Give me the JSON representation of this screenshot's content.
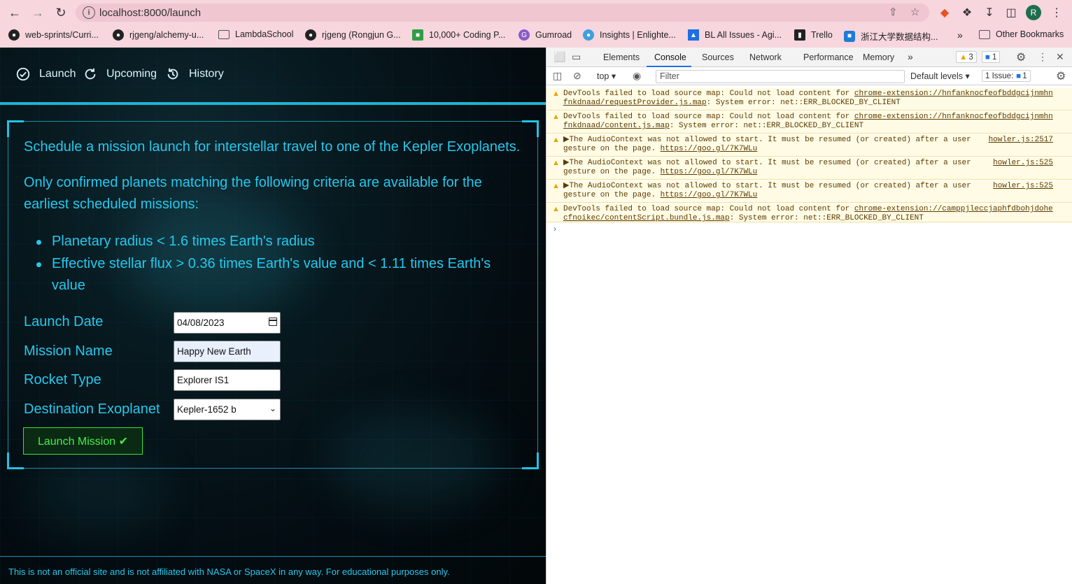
{
  "browser": {
    "url": "localhost:8000/launch",
    "bookmarks": [
      "web-sprints/Curri...",
      "rjgeng/alchemy-u...",
      "LambdaSchool",
      "rjgeng (Rongjun G...",
      "10,000+ Coding P...",
      "Gumroad",
      "Insights | Enlighte...",
      "BL All Issues - Agi...",
      "Trello",
      "浙江大学数据结构...",
      "»",
      "Other Bookmarks"
    ],
    "avatar_letter": "R"
  },
  "app": {
    "nav": [
      {
        "label": "Launch"
      },
      {
        "label": "Upcoming"
      },
      {
        "label": "History"
      }
    ],
    "intro": "Schedule a mission launch for interstellar travel to one of the Kepler Exoplanets.",
    "criteria_intro": "Only confirmed planets matching the following criteria are available for the earliest scheduled missions:",
    "criteria": [
      "Planetary radius < 1.6 times Earth's radius",
      "Effective stellar flux > 0.36 times Earth's value and < 1.11 times Earth's value"
    ],
    "form": {
      "launch_date_label": "Launch Date",
      "launch_date_value": "04/08/2023",
      "mission_name_label": "Mission Name",
      "mission_name_value": "Happy New Earth",
      "rocket_type_label": "Rocket Type",
      "rocket_type_value": "Explorer IS1",
      "destination_label": "Destination Exoplanet",
      "destination_value": "Kepler-1652 b",
      "submit_label": "Launch Mission ✔"
    },
    "footer": "This is not an official site and is not affiliated with NASA or SpaceX in any way. For educational purposes only."
  },
  "devtools": {
    "tabs": [
      "Elements",
      "Console",
      "Sources",
      "Network",
      "Performance",
      "Memory"
    ],
    "more": "»",
    "warning_count": "3",
    "message_count": "1",
    "context": "top",
    "filter_placeholder": "Filter",
    "levels": "Default levels",
    "issues_label": "1 Issue:",
    "issues_count": "1",
    "messages": [
      {
        "l1": "DevTools failed to load source map: Could not load content for ",
        "link1": "chrome-extension://hnfanknocfeofbddgcijnmhn",
        "l2link": "fnkdnaad/requestProvider.js.map",
        "l2": ": System error: net::ERR_BLOCKED_BY_CLIENT",
        "src": ""
      },
      {
        "l1": "DevTools failed to load source map: Could not load content for ",
        "link1": "chrome-extension://hnfanknocfeofbddgcijnmhn",
        "l2link": "fnkdnaad/content.js.map",
        "l2": ": System error: net::ERR_BLOCKED_BY_CLIENT",
        "src": ""
      },
      {
        "l1": "▶The AudioContext was not allowed to start. It must be resumed (or created) after a user",
        "link1": "",
        "l2": "gesture on the page. ",
        "l2link": "https://goo.gl/7K7WLu",
        "src": "howler.js:2517"
      },
      {
        "l1": "▶The AudioContext was not allowed to start. It must be resumed (or created) after a user",
        "link1": "",
        "l2": "gesture on the page. ",
        "l2link": "https://goo.gl/7K7WLu",
        "src": "howler.js:525"
      },
      {
        "l1": "▶The AudioContext was not allowed to start. It must be resumed (or created) after a user",
        "link1": "",
        "l2": "gesture on the page. ",
        "l2link": "https://goo.gl/7K7WLu",
        "src": "howler.js:525"
      },
      {
        "l1": "DevTools failed to load source map: Could not load content for ",
        "link1": "chrome-extension://camppjleccjaphfdbohjdohe",
        "l2link": "cfnoikec/contentScript.bundle.js.map",
        "l2": ": System error: net::ERR_BLOCKED_BY_CLIENT",
        "src": ""
      }
    ],
    "prompt": "›"
  }
}
